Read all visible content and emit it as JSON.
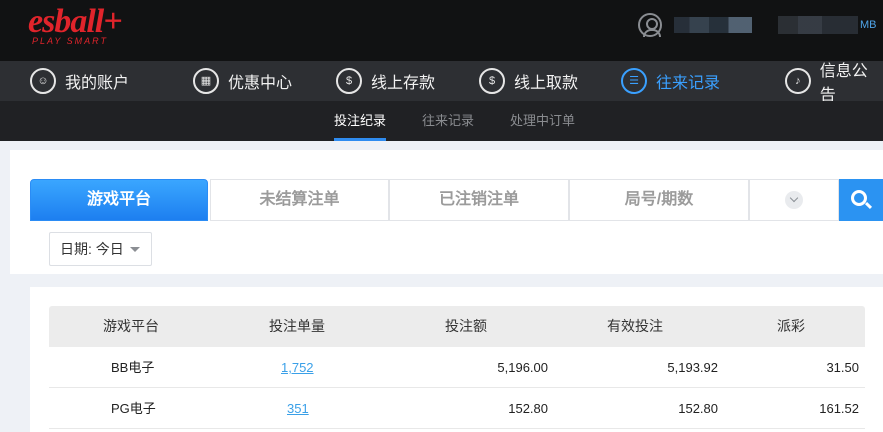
{
  "brand": {
    "logo_text": "esball+",
    "tagline": "PLAY SMART"
  },
  "user": {
    "name_tail": "MB"
  },
  "main_nav": [
    {
      "label": "我的账户",
      "icon": "user-icon"
    },
    {
      "label": "优惠中心",
      "icon": "gift-icon"
    },
    {
      "label": "线上存款",
      "icon": "deposit-icon"
    },
    {
      "label": "线上取款",
      "icon": "withdraw-icon"
    },
    {
      "label": "往来记录",
      "icon": "records-icon",
      "active": true
    },
    {
      "label": "信息公告",
      "icon": "bell-icon"
    }
  ],
  "sub_nav": [
    {
      "label": "投注纪录",
      "active": true
    },
    {
      "label": "往来记录"
    },
    {
      "label": "处理中订单"
    }
  ],
  "tabs": [
    {
      "label": "游戏平台",
      "active": true
    },
    {
      "label": "未结算注单"
    },
    {
      "label": "已注销注单"
    },
    {
      "label": "局号/期数"
    }
  ],
  "filter": {
    "date_label": "日期: 今日"
  },
  "table": {
    "headers": [
      "游戏平台",
      "投注单量",
      "投注额",
      "有效投注",
      "派彩"
    ],
    "rows": [
      [
        "BB电子",
        "1,752",
        "5,196.00",
        "5,193.92",
        "31.50"
      ],
      [
        "PG电子",
        "351",
        "152.80",
        "152.80",
        "161.52"
      ]
    ]
  },
  "colors": {
    "accent": "#2b93f2",
    "brand_red": "#e0242b",
    "nav_bg": "#2d2f33",
    "top_bg": "#111213"
  }
}
